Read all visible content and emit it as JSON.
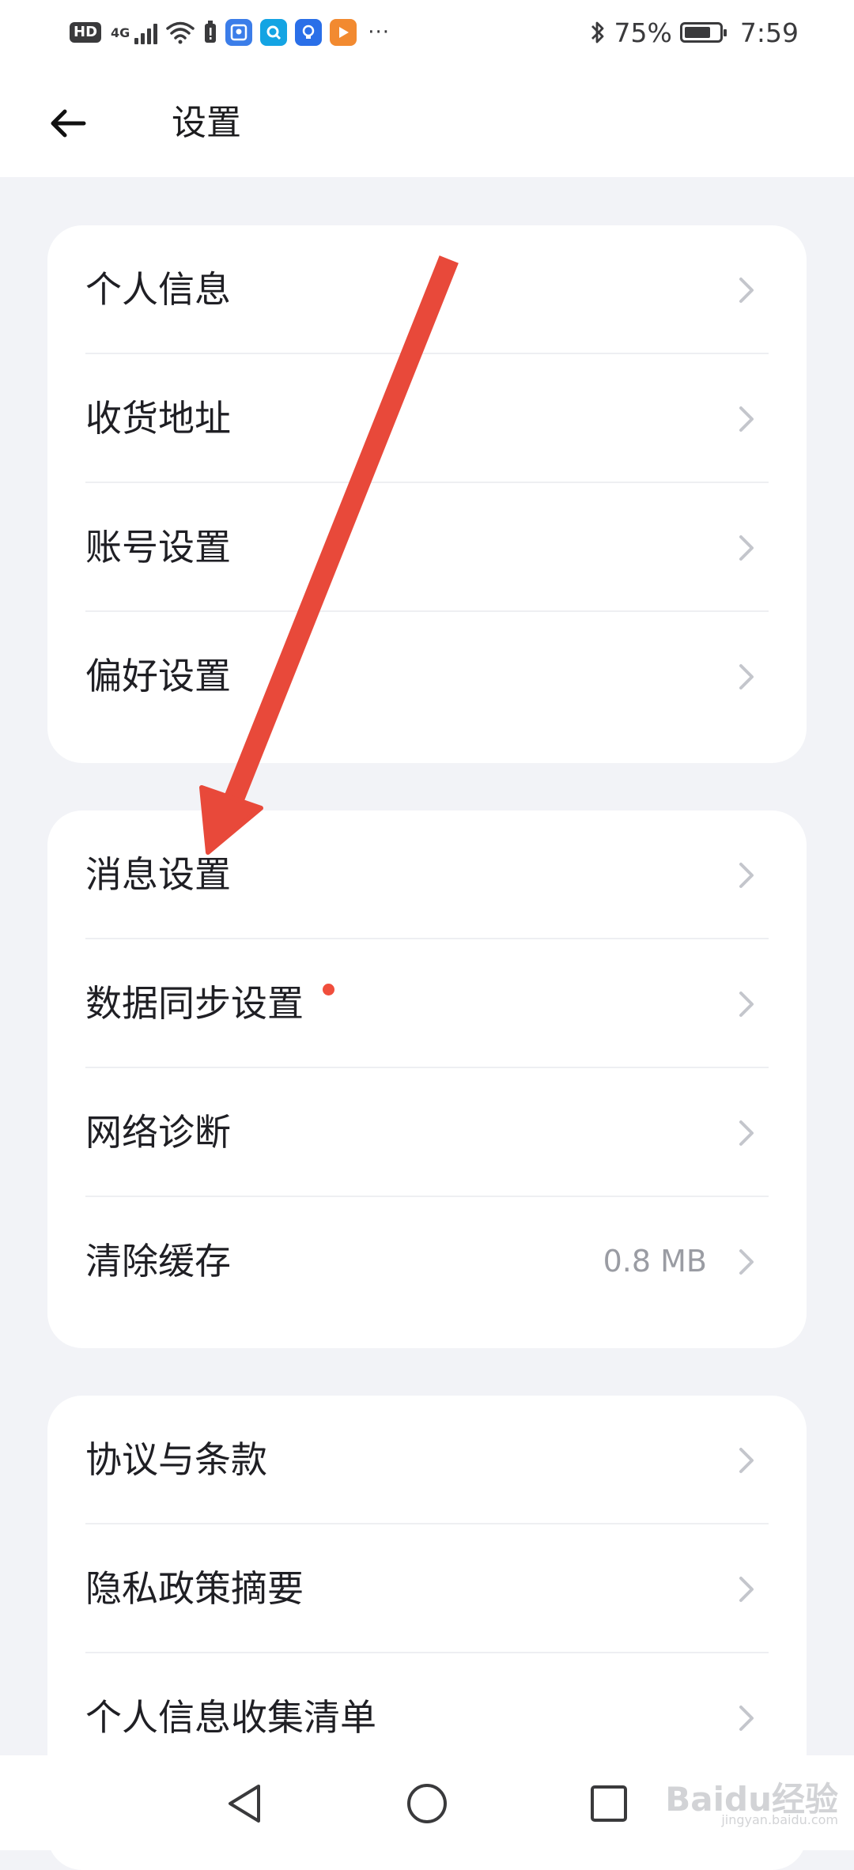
{
  "status_bar": {
    "hd": "HD",
    "network": "4G",
    "more": "···",
    "battery_text": "75%",
    "battery_level": 0.75,
    "time": "7:59",
    "icons": [
      "signal-icon",
      "wifi-icon",
      "alert-icon",
      "app-icon-blue",
      "app-icon-search",
      "app-icon-bulb",
      "app-icon-play",
      "bluetooth-icon",
      "battery-icon"
    ]
  },
  "header": {
    "title": "设置",
    "back_icon": "back-arrow-icon"
  },
  "groups": [
    {
      "items": [
        {
          "label": "个人信息"
        },
        {
          "label": "收货地址"
        },
        {
          "label": "账号设置"
        },
        {
          "label": "偏好设置"
        }
      ]
    },
    {
      "items": [
        {
          "label": "消息设置"
        },
        {
          "label": "数据同步设置",
          "badge": "dot"
        },
        {
          "label": "网络诊断"
        },
        {
          "label": "清除缓存",
          "value": "0.8 MB"
        }
      ]
    },
    {
      "items": [
        {
          "label": "协议与条款"
        },
        {
          "label": "隐私政策摘要"
        },
        {
          "label": "个人信息收集清单"
        }
      ]
    }
  ],
  "nav_bar": {
    "buttons": [
      "back-triangle-icon",
      "home-circle-icon",
      "recents-square-icon"
    ]
  },
  "watermark": {
    "brand": "Baidu经验",
    "site": "jingyan.baidu.com"
  },
  "colors": {
    "accent_red": "#f04e3c",
    "background": "#f2f3f7",
    "card": "#ffffff",
    "chevron": "#c4c6cc"
  }
}
